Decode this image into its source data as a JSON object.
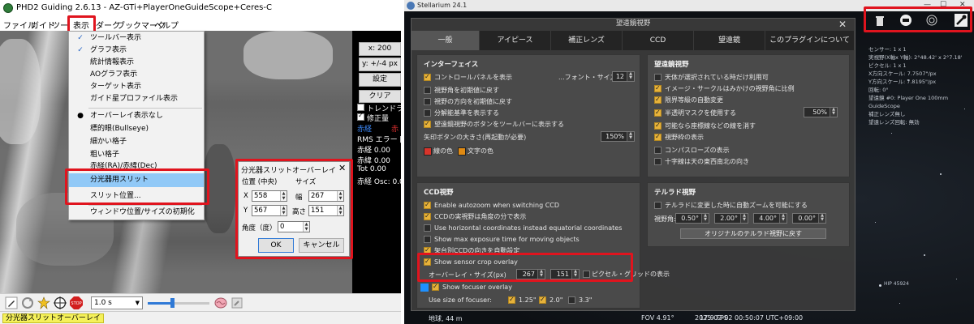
{
  "phd": {
    "title": "PHD2 Guiding 2.6.13 - AZ-GTi+PlayerOneGuideScope+Ceres-C",
    "menubar": [
      "ファイル",
      "ガイド",
      "ツー",
      "表示",
      "ダーク",
      "ブックマーク",
      "ヘルプ"
    ],
    "view_menu": {
      "items": [
        {
          "label": "ツールバー表示",
          "checked": true
        },
        {
          "label": "グラフ表示",
          "checked": true
        },
        {
          "label": "統計情報表示"
        },
        {
          "label": "AOグラフ表示"
        },
        {
          "label": "ターゲット表示"
        },
        {
          "label": "ガイド星プロファイル表示"
        },
        {
          "label": "オーバーレイ表示なし",
          "selected": true
        },
        {
          "label": "標的眼(Bullseye)"
        },
        {
          "label": "細かい格子"
        },
        {
          "label": "粗い格子"
        },
        {
          "label": "赤経(RA)/赤緯(Dec)"
        },
        {
          "label": "分光器用スリット",
          "highlighted": true
        },
        {
          "label": "スリット位置..."
        },
        {
          "label": "ウィンドウ位置/サイズの初期化"
        }
      ]
    },
    "sidepanel": {
      "x_label": "x: 200",
      "y_label": "y: +/-4 px",
      "settings_button": "設定",
      "clear_button": "クリア",
      "trend_line": "トレンドライン",
      "correction": "修正量",
      "ra_label": "赤経",
      "rms_error": "RMS エラー [px]",
      "ra_value": "赤経 0.00",
      "dec_value": "赤緯 0.00",
      "tot_value": "Tot 0.00",
      "ra_osc": "赤経 Osc: 0.00",
      "partial_tag": "赤"
    },
    "dialog": {
      "title": "分光器スリットオーバーレイ",
      "close": "✕",
      "position_header": "位置 (中央)",
      "size_header": "サイズ",
      "x_label": "X",
      "x_value": "558",
      "y_label": "Y",
      "y_value": "567",
      "width_label": "幅",
      "width_value": "267",
      "height_label": "高さ",
      "height_value": "151",
      "angle_label": "角度（度）",
      "angle_value": "0",
      "ok": "OK",
      "cancel": "キャンセル"
    },
    "toolbar": {
      "exposure": "1.0 s"
    },
    "status_label": "分光器スリットオーバーレイ"
  },
  "stellarium": {
    "title": "Stellarium 24.1",
    "window_controls": [
      "—",
      "☐",
      "✕"
    ],
    "panel": {
      "title": "望遠鏡視野",
      "close": "✕",
      "tabs": [
        "一般",
        "アイピース",
        "補正レンズ",
        "CCD",
        "望遠鏡",
        "このプラグインについて"
      ],
      "interface": {
        "header": "インターフェイス",
        "items": [
          {
            "label": "コントロールパネルを表示",
            "checked": true
          },
          {
            "label": "視野角を初期値に戻す",
            "checked": false
          },
          {
            "label": "視野の方向を初期値に戻す",
            "checked": false
          },
          {
            "label": "分解能基準を表示する",
            "checked": false
          },
          {
            "label": "望遠鏡視野のボタンをツールバーに表示する",
            "checked": true
          }
        ],
        "font_size_label": "...フォント・サイズ",
        "font_size_value": "12",
        "arrow_button_label": "矢印ボタンの大きさ(再起動が必要)",
        "arrow_button_value": "150%",
        "line_color_label": "線の色",
        "text_color_label": "文字の色",
        "line_color": "#d8342b",
        "text_color": "#e08a13"
      },
      "telescope_view": {
        "header": "望遠鏡視野",
        "items": [
          {
            "label": "天体が選択されている時だけ利用可",
            "checked": false
          },
          {
            "label": "イメージ・サークルはみかけの視野角に比例",
            "checked": true
          },
          {
            "label": "限界等級の自動変更",
            "checked": true
          },
          {
            "label": "半透明マスクを使用する",
            "checked": true
          },
          {
            "label": "可能なら座標線などの線を消す",
            "checked": true
          },
          {
            "label": "視野枠の表示",
            "checked": true
          },
          {
            "label": "コンパスローズの表示",
            "checked": false
          },
          {
            "label": "十字線は天の東西南北の向き",
            "checked": false
          }
        ],
        "mask_value": "50%"
      },
      "ccd_view": {
        "header": "CCD視野",
        "items": [
          {
            "label": "Enable autozoom when switching CCD",
            "checked": true
          },
          {
            "label": "CCDの実視野は角度の分で表示",
            "checked": true
          },
          {
            "label": "Use horizontal coordinates instead equatorial coordinates",
            "checked": false
          },
          {
            "label": "Show max exposure time for moving objects",
            "checked": false
          },
          {
            "label": "架台別CCDの向きを自動設定",
            "checked": true
          },
          {
            "label": "Show sensor crop overlay",
            "checked": true
          }
        ],
        "overlay_size_label": "オーバーレイ・サイズ(px)",
        "overlay_width": "267",
        "overlay_height": "151",
        "pixel_grid_label": "ピクセル・グリッドの表示",
        "show_focuser": "Show focuser overlay",
        "focuser_label": "Use size of focuser:",
        "focuser_options": [
          {
            "label": "1.25\"",
            "checked": true
          },
          {
            "label": "2.0\"",
            "checked": true
          },
          {
            "label": "3.3\"",
            "checked": false
          }
        ]
      },
      "telrad": {
        "header": "テルラド視野",
        "auto_label": "テルラドに変更した時に自動ズームを可能にする",
        "fov_label": "視野角:",
        "fov_values": [
          "0.50°",
          "2.00°",
          "4.00°",
          "0.00°"
        ],
        "reset_button": "オリジナルのテルラド視野に戻す"
      }
    },
    "statusbar": {
      "location": "地球, 44 m",
      "fov": "FOV 4.91°",
      "fps": "17.9 FPS",
      "datetime": "2025-02-02 00:50:07 UTC+09:00"
    },
    "info_lines": [
      "センサー: 1 x 1",
      "実視野(X軸x Y軸): 2°48.42' x 2°7.18'",
      "ピクセル: 1 x 1",
      "X方向スケール: 7.7507\"/px",
      "Y方向スケール: 7.8195\"/px",
      "回転: 0°",
      "望遠鏡 #0: Player One 100mm",
      "GuideScope",
      "補正レンズ無し",
      "望遠レンズ回転: 無効"
    ],
    "star_label": "HIP 45924"
  }
}
